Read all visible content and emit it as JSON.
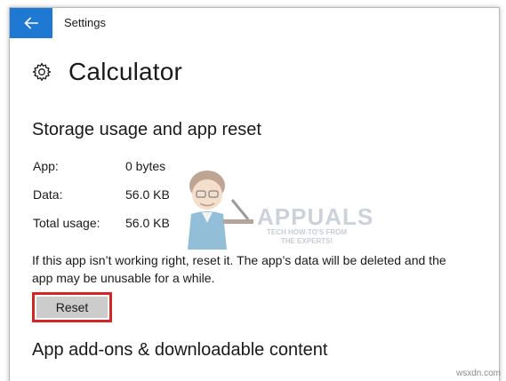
{
  "window": {
    "title": "Settings"
  },
  "page": {
    "title": "Calculator"
  },
  "storage": {
    "section_title": "Storage usage and app reset",
    "rows": [
      {
        "label": "App:",
        "value": "0 bytes"
      },
      {
        "label": "Data:",
        "value": "56.0 KB"
      },
      {
        "label": "Total usage:",
        "value": "56.0 KB"
      }
    ],
    "description": "If this app isn’t working right, reset it. The app’s data will be deleted and the app may be unusable for a while.",
    "reset_label": "Reset"
  },
  "addons": {
    "section_title": "App add-ons & downloadable content"
  },
  "watermark": {
    "brand": "APPUALS",
    "tagline": "TECH HOW-TO'S FROM THE EXPERTS!"
  },
  "credit": "wsxdn.com",
  "colors": {
    "accent": "#1f78d1",
    "highlight_border": "#d32626",
    "button_bg": "#cccccc"
  },
  "icons": {
    "back": "arrow-left-icon",
    "page": "gear-icon"
  }
}
